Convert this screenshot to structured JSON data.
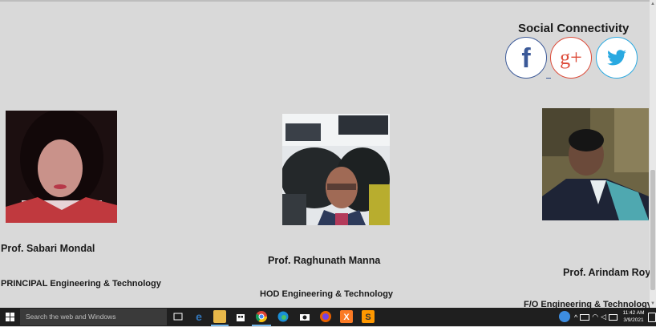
{
  "social": {
    "title": "Social Connectivity",
    "icons": [
      {
        "name": "facebook-icon",
        "color": "#3b5998"
      },
      {
        "name": "google-plus-icon",
        "color": "#dd4b39"
      },
      {
        "name": "twitter-icon",
        "color": "#29a9e1"
      }
    ]
  },
  "faculty": [
    {
      "name": "Prof. Sabari Mondal",
      "role": "PRINCIPAL Engineering & Technology"
    },
    {
      "name": "Prof. Raghunath Manna",
      "role": "HOD Engineering & Technology"
    },
    {
      "name": "Prof. Arindam Roy",
      "role": "F/O Engineering & Technology"
    }
  ],
  "taskbar": {
    "search_placeholder": "Search the web and Windows",
    "clock": {
      "time": "11:42 AM",
      "date": "3/9/2021"
    },
    "apps": [
      "task-view-icon",
      "edge-icon",
      "file-explorer-icon",
      "store-icon",
      "chrome-icon",
      "edge-chromium-icon",
      "camera-icon",
      "firefox-icon",
      "xampp-icon",
      "sublime-text-icon"
    ]
  }
}
